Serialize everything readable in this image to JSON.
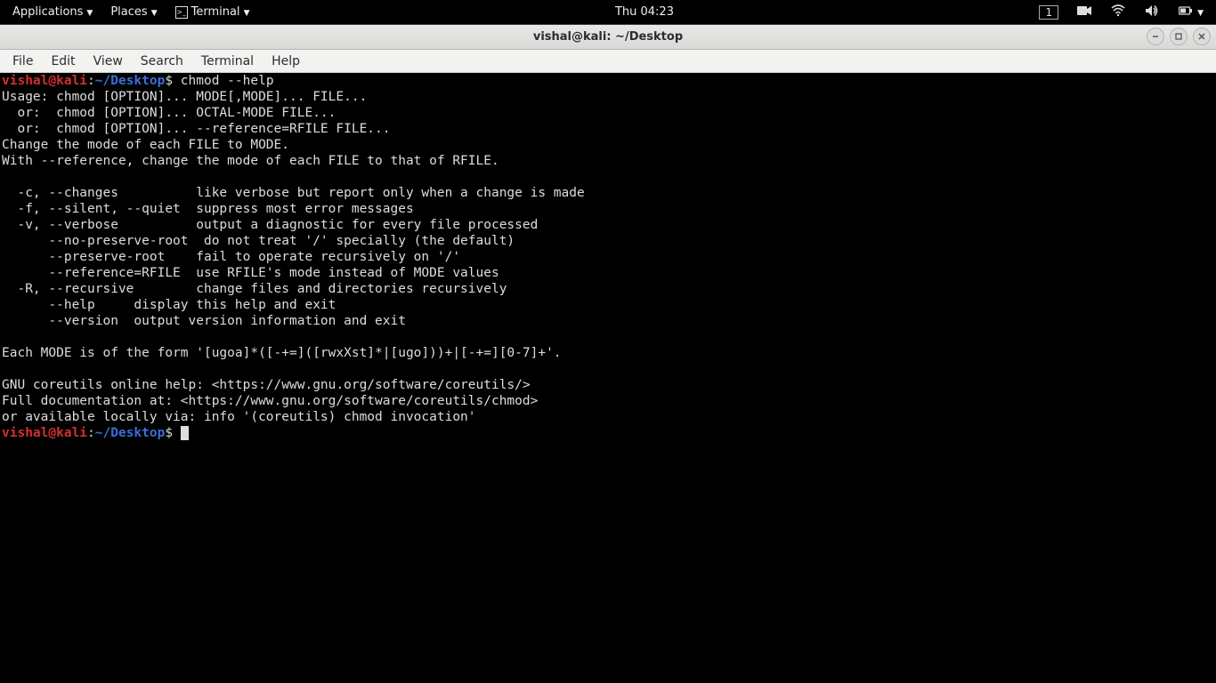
{
  "panel": {
    "applications": "Applications",
    "places": "Places",
    "terminal": "Terminal",
    "clock": "Thu 04:23",
    "workspace": "1"
  },
  "window": {
    "title": "vishal@kali: ~/Desktop"
  },
  "menubar": {
    "file": "File",
    "edit": "Edit",
    "view": "View",
    "search": "Search",
    "terminal": "Terminal",
    "help": "Help"
  },
  "prompt": {
    "user": "vishal@kali",
    "sep": ":",
    "tilde": "~",
    "slash": "/",
    "path": "Desktop",
    "dollar": "$"
  },
  "term": {
    "cmd1": " chmod --help",
    "l01": "Usage: chmod [OPTION]... MODE[,MODE]... FILE...",
    "l02": "  or:  chmod [OPTION]... OCTAL-MODE FILE...",
    "l03": "  or:  chmod [OPTION]... --reference=RFILE FILE...",
    "l04": "Change the mode of each FILE to MODE.",
    "l05": "With --reference, change the mode of each FILE to that of RFILE.",
    "l06": "",
    "l07": "  -c, --changes          like verbose but report only when a change is made",
    "l08": "  -f, --silent, --quiet  suppress most error messages",
    "l09": "  -v, --verbose          output a diagnostic for every file processed",
    "l10": "      --no-preserve-root  do not treat '/' specially (the default)",
    "l11": "      --preserve-root    fail to operate recursively on '/'",
    "l12": "      --reference=RFILE  use RFILE's mode instead of MODE values",
    "l13": "  -R, --recursive        change files and directories recursively",
    "l14": "      --help     display this help and exit",
    "l15": "      --version  output version information and exit",
    "l16": "",
    "l17": "Each MODE is of the form '[ugoa]*([-+=]([rwxXst]*|[ugo]))+|[-+=][0-7]+'.",
    "l18": "",
    "l19": "GNU coreutils online help: <https://www.gnu.org/software/coreutils/>",
    "l20": "Full documentation at: <https://www.gnu.org/software/coreutils/chmod>",
    "l21": "or available locally via: info '(coreutils) chmod invocation'"
  }
}
